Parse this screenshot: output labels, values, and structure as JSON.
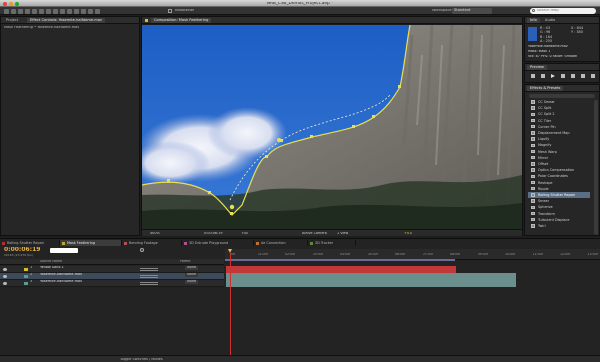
{
  "window": {
    "title": "NAB_CS6_Demos_Project.aep *"
  },
  "toolbar": {
    "roto_label": "RotoBezier",
    "workspace_label": "Workspace:",
    "workspace_value": "Standard",
    "search_placeholder": "Search Help"
  },
  "project_panel": {
    "tabs": [
      "Project",
      "Effect Controls: Yosemite-halfdome.mov"
    ],
    "subheader": "Mask Feathering • Yosemite-halfdome.mov"
  },
  "composition": {
    "tab_label": "Composition: Mask Feathering",
    "sub_tab": "Mask Feathering",
    "footer": {
      "zoom": "400%",
      "timecode": "0:00:06:19",
      "resolution": "Full",
      "camera": "Active Camera",
      "view": "1 View",
      "exposure": "+0.0"
    }
  },
  "info_panel": {
    "tabs": [
      "Info",
      "Audio"
    ],
    "rgb": [
      {
        "label": "R",
        "value": "43"
      },
      {
        "label": "G",
        "value": "96"
      },
      {
        "label": "B",
        "value": "184"
      },
      {
        "label": "A",
        "value": "255"
      }
    ],
    "xy": [
      {
        "label": "X",
        "value": "844"
      },
      {
        "label": "Y",
        "value": "380"
      }
    ],
    "swatch_color": "#2b60b8",
    "lines": [
      "Yosemite-halfdome.mov",
      "Mask: Mask 1",
      "Vtx: 87 Pt%: 0 Falloff: Smooth"
    ]
  },
  "preview_panel": {
    "title": "Preview"
  },
  "effects_panel": {
    "title": "Effects & Presets",
    "selected": "Rolling Shutter Repair",
    "items": [
      "CC Smear",
      "CC Split",
      "CC Split 2",
      "CC Tiler",
      "Corner Pin",
      "Displacement Map",
      "Liquify",
      "Magnify",
      "Mesh Warp",
      "Mirror",
      "Offset",
      "Optics Compensation",
      "Polar Coordinates",
      "Reshape",
      "Ripple",
      "Rolling Shutter Repair",
      "Smear",
      "Spherize",
      "Transform",
      "Turbulent Displace",
      "Twirl"
    ]
  },
  "timeline": {
    "tabs": [
      {
        "label": "Rolling Shutter Repair",
        "color": "#b03030"
      },
      {
        "label": "Mask Feathering",
        "color": "#c8a030"
      },
      {
        "label": "Bending Footage",
        "color": "#b05050"
      },
      {
        "label": "3D Extrude Playground",
        "color": "#b05090"
      },
      {
        "label": "Ae Connection",
        "color": "#c07030"
      },
      {
        "label": "3D Tracker",
        "color": "#5a8a3a"
      }
    ],
    "timecode": "0:00:06:19",
    "frame_info": "00163 (23.976 fps)",
    "columns": {
      "name": "Source Name",
      "parent": "Parent"
    },
    "layers": [
      {
        "num": "1",
        "name": "Yellow Solid 1",
        "parent": "None",
        "color": "#d8c020",
        "bar_color": "#c23838"
      },
      {
        "num": "2",
        "name": "Yosemite-halfdome.mov",
        "parent": "None",
        "color": "#5a9a9a",
        "bar_color": "#6b8f8c"
      },
      {
        "num": "3",
        "name": "Yosemite-halfdome.mov",
        "parent": "None",
        "color": "#5a9a9a",
        "bar_color": "#6b8f8c"
      }
    ],
    "ruler": [
      "00f",
      "01:00f",
      "02:00f",
      "03:00f",
      "04:00f",
      "05:00f",
      "06:00f",
      "07:00f",
      "08:00f",
      "09:00f",
      "10:00f",
      "11:00f",
      "12:00f",
      "13:00f"
    ],
    "footer": "Toggle Switches / Modes"
  },
  "icons": {
    "search": "magnifier-icon",
    "play": "play-icon",
    "stopwatch": "stopwatch-icon",
    "eye": "eye-icon"
  }
}
